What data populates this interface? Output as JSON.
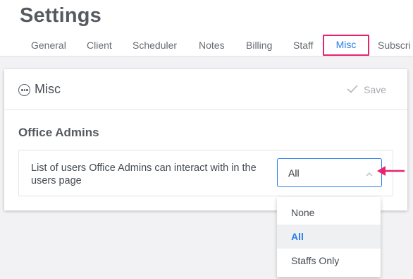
{
  "header": {
    "title": "Settings",
    "tabs": [
      {
        "label": "General"
      },
      {
        "label": "Client"
      },
      {
        "label": "Scheduler"
      },
      {
        "label": "Notes"
      },
      {
        "label": "Billing"
      },
      {
        "label": "Staff"
      },
      {
        "label": "Misc"
      },
      {
        "label": "Subscri"
      }
    ],
    "active_tab": "Misc"
  },
  "card": {
    "icon": "more-horizontal-icon",
    "title": "Misc",
    "save_label": "Save",
    "section_title": "Office Admins",
    "setting": {
      "label": "List of users Office Admins can interact with in the users page",
      "selected_value": "All",
      "options": [
        "None",
        "All",
        "Staffs Only"
      ]
    }
  },
  "colors": {
    "accent": "#2b7de9",
    "highlight": "#e8246f"
  }
}
